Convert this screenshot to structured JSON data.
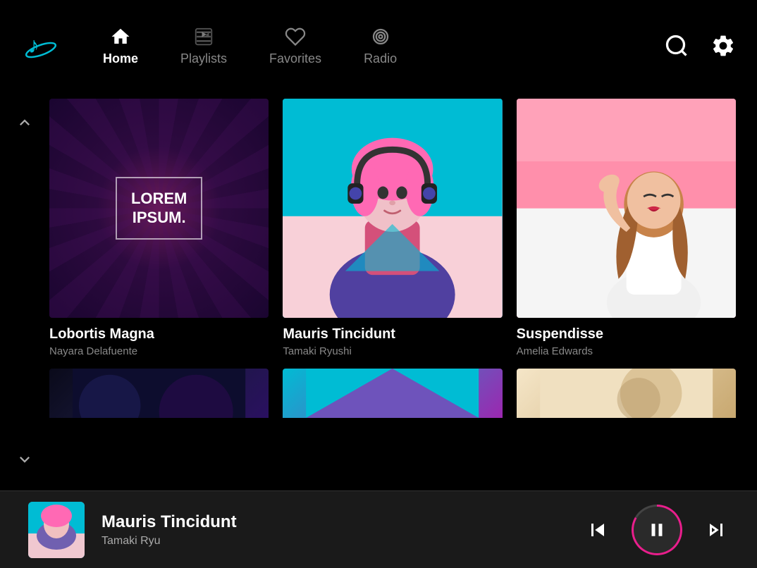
{
  "app": {
    "logo_label": "Music App"
  },
  "nav": {
    "items": [
      {
        "id": "home",
        "label": "Home",
        "active": true
      },
      {
        "id": "playlists",
        "label": "Playlists",
        "active": false
      },
      {
        "id": "favorites",
        "label": "Favorites",
        "active": false
      },
      {
        "id": "radio",
        "label": "Radio",
        "active": false
      }
    ],
    "search_label": "Search",
    "settings_label": "Settings"
  },
  "grid": {
    "cards": [
      {
        "id": "card1",
        "title": "Lobortis Magna",
        "subtitle": "Nayara Delafuente",
        "thumb_type": "lorem"
      },
      {
        "id": "card2",
        "title": "Mauris Tincidunt",
        "subtitle": "Tamaki Ryushi",
        "thumb_type": "mauris"
      },
      {
        "id": "card3",
        "title": "Suspendisse",
        "subtitle": "Amelia Edwards",
        "thumb_type": "suspendisse"
      }
    ],
    "lorem_line1": "LOREM",
    "lorem_line2": "IPSUM."
  },
  "player": {
    "title": "Mauris Tincidunt",
    "subtitle": "Tamaki Ryu",
    "prev_label": "Previous",
    "pause_label": "Pause",
    "next_label": "Next"
  },
  "arrows": {
    "up": "▲",
    "down": "▼"
  }
}
